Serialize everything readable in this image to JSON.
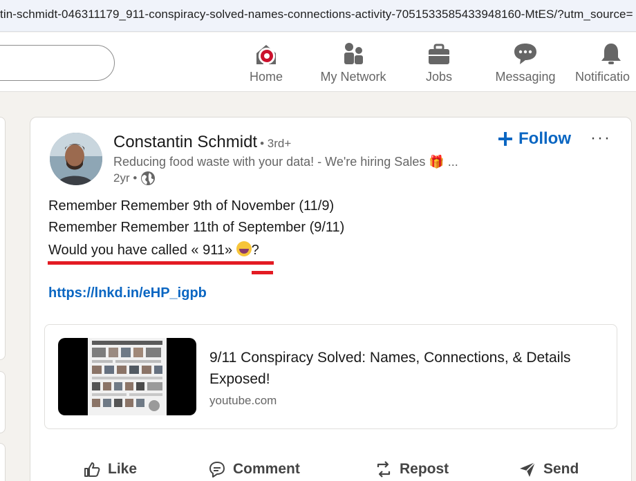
{
  "browser": {
    "url": "tin-schmidt-046311179_911-conspiracy-solved-names-connections-activity-7051533585433948160-MtES/?utm_source="
  },
  "nav": {
    "items": [
      {
        "label": "Home",
        "icon": "home-icon"
      },
      {
        "label": "My Network",
        "icon": "network-icon"
      },
      {
        "label": "Jobs",
        "icon": "briefcase-icon"
      },
      {
        "label": "Messaging",
        "icon": "messaging-icon"
      },
      {
        "label": "Notificatio",
        "icon": "bell-icon"
      }
    ],
    "accent": "#cb112d"
  },
  "post": {
    "author": "Constantin Schmidt",
    "degree": "• 3rd+",
    "headline": "Reducing food waste with your data! - We're hiring Sales 🎁 ...",
    "time": "2yr •",
    "follow_label": "Follow",
    "more_label": "···",
    "lines": [
      "Remember Remember 9th of November (11/9)",
      "Remember Remember 11th of September (9/11)"
    ],
    "line3_text": "Would you have called « 911»",
    "line3_end": "?",
    "link": "https://lnkd.in/eHP_igpb",
    "preview": {
      "title": "9/11 Conspiracy Solved: Names, Connections, & Details Exposed!",
      "source": "youtube.com"
    },
    "actions": {
      "like": "Like",
      "comment": "Comment",
      "repost": "Repost",
      "send": "Send"
    }
  },
  "colors": {
    "link": "#0a66c2",
    "annotation": "#e31b23",
    "background": "#f4f2ee"
  }
}
